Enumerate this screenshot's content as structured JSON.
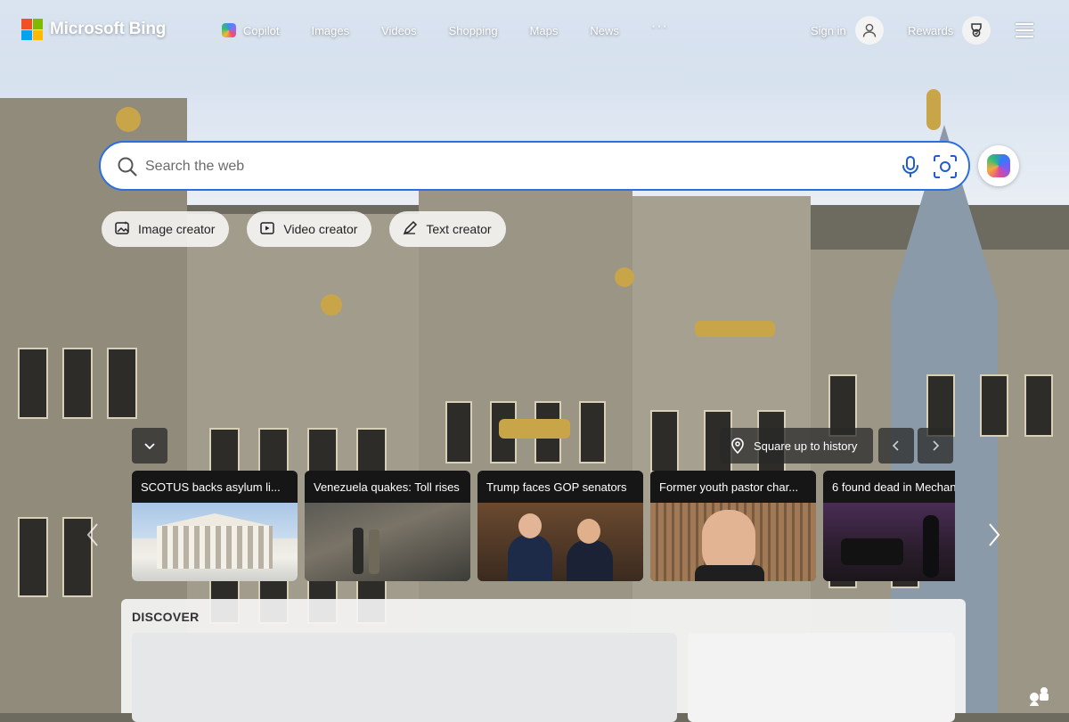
{
  "header": {
    "logo_text": "Microsoft Bing",
    "nav": [
      {
        "label": "Copilot",
        "icon": "copilot-icon"
      },
      {
        "label": "Images"
      },
      {
        "label": "Videos"
      },
      {
        "label": "Shopping"
      },
      {
        "label": "Maps"
      },
      {
        "label": "News"
      },
      {
        "label": "···",
        "icon": "more-icon"
      }
    ],
    "sign_in_label": "Sign in",
    "rewards_label": "Rewards",
    "menu_icon": "hamburger-icon"
  },
  "search": {
    "placeholder": "Search the web",
    "value": "",
    "icons": [
      "search-icon",
      "microphone-icon",
      "visual-search-icon",
      "copilot-icon"
    ]
  },
  "creators": [
    {
      "label": "Image creator",
      "icon": "image-creator-icon"
    },
    {
      "label": "Video creator",
      "icon": "video-creator-icon"
    },
    {
      "label": "Text creator",
      "icon": "text-creator-icon"
    }
  ],
  "image_of_day": {
    "title": "Square up to history"
  },
  "news": [
    {
      "title": "SCOTUS backs asylum li..."
    },
    {
      "title": "Venezuela quakes: Toll rises"
    },
    {
      "title": "Trump faces GOP senators"
    },
    {
      "title": "Former youth pastor char..."
    },
    {
      "title": "6 found dead in Mechan"
    }
  ],
  "discover": {
    "title": "DISCOVER"
  },
  "colors": {
    "accent": "#2b6fe0",
    "logo_red": "#f25022",
    "logo_green": "#7fba00",
    "logo_blue": "#00a4ef",
    "logo_yellow": "#ffb900"
  }
}
